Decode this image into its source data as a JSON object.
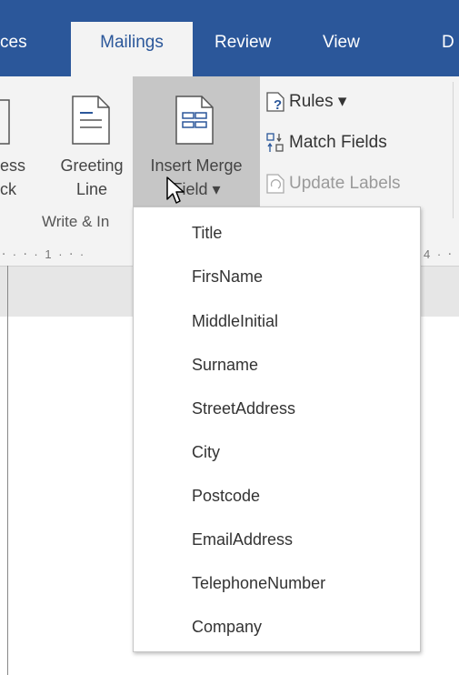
{
  "tabs": [
    "ces",
    "Mailings",
    "Review",
    "View",
    "D"
  ],
  "ribbon": {
    "address_block_lines": [
      "ess",
      "ck"
    ],
    "greeting_line": [
      "Greeting",
      "Line"
    ],
    "insert_merge_field": [
      "Insert Merge",
      "Field ▾"
    ],
    "group_label": "Write & In",
    "rules": "Rules ▾",
    "match_fields": "Match Fields",
    "update_labels": "Update Labels"
  },
  "ruler": {
    "left_text": "‧ · ‧ · 1 · ‧ ·",
    "right_text": "4 · ‧"
  },
  "dropdown": {
    "items": [
      "Title",
      "FirsName",
      "MiddleInitial",
      "Surname",
      "StreetAddress",
      "City",
      "Postcode",
      "EmailAddress",
      "TelephoneNumber",
      "Company"
    ]
  },
  "colors": {
    "accent": "#2b579a",
    "ribbon_bg": "#f3f3f3",
    "hover": "#c6c6c6"
  }
}
